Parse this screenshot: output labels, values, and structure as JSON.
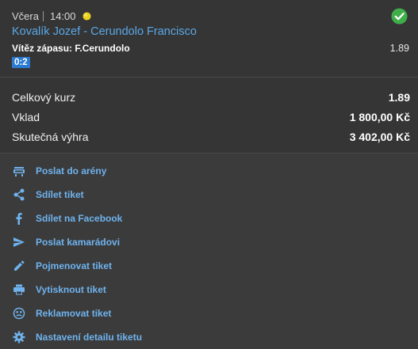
{
  "bet": {
    "day": "Včera",
    "time": "14:00",
    "match": "Kovalík Jozef - Cerundolo Francisco",
    "pick_label": "Vítěz zápasu: F.Cerundolo",
    "pick_odds": "1.89",
    "score": "0:2",
    "status_color": "#3fae49"
  },
  "summary": {
    "total_odds_label": "Celkový kurz",
    "total_odds_value": "1.89",
    "stake_label": "Vklad",
    "stake_value": "1 800,00 Kč",
    "win_label": "Skutečná výhra",
    "win_value": "3 402,00 Kč"
  },
  "actions": [
    {
      "label": "Poslat do arény",
      "icon": "arena-icon"
    },
    {
      "label": "Sdílet tiket",
      "icon": "share-icon"
    },
    {
      "label": "Sdílet na Facebook",
      "icon": "facebook-icon"
    },
    {
      "label": "Poslat kamarádovi",
      "icon": "send-icon"
    },
    {
      "label": "Pojmenovat tiket",
      "icon": "pencil-icon"
    },
    {
      "label": "Vytisknout tiket",
      "icon": "printer-icon"
    },
    {
      "label": "Reklamovat tiket",
      "icon": "sad-face-icon"
    },
    {
      "label": "Nastavení detailu tiketu",
      "icon": "gear-icon"
    }
  ],
  "colors": {
    "accent_link": "#5aa8e8",
    "badge": "#2b7bd3",
    "icon": "#6fb3ee"
  }
}
